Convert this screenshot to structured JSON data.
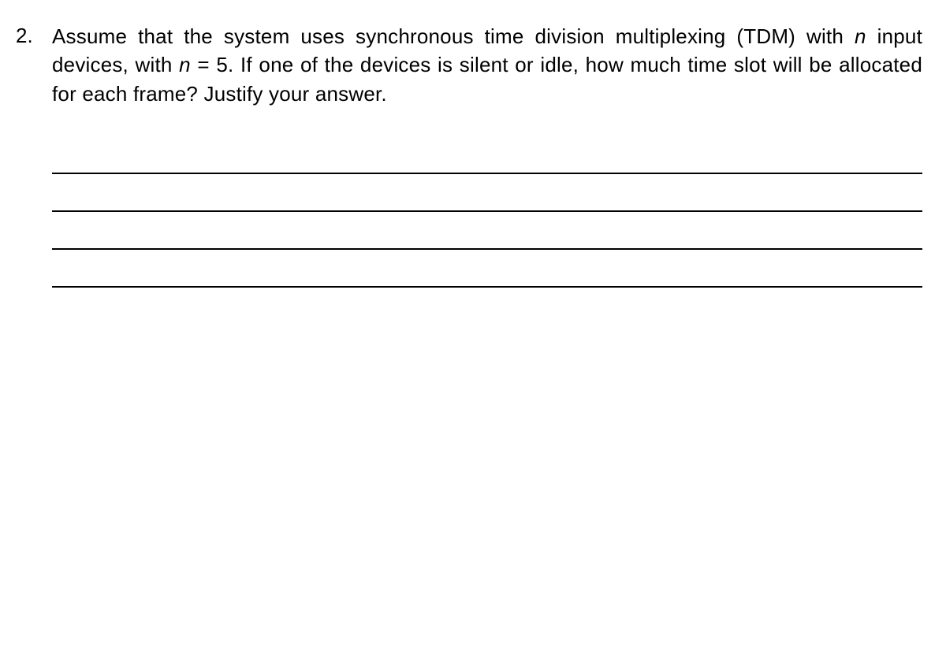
{
  "question": {
    "number": "2.",
    "prefix": "Assume that the system uses synchronous time division multiplexing (TDM) with ",
    "var1": "n",
    "mid1": " input devices, with ",
    "var2": "n",
    "mid2": " = 5. If one of the devices is silent or idle, how much time slot will be allocated for each frame? Justify your answer."
  },
  "answer_line_count": 4
}
